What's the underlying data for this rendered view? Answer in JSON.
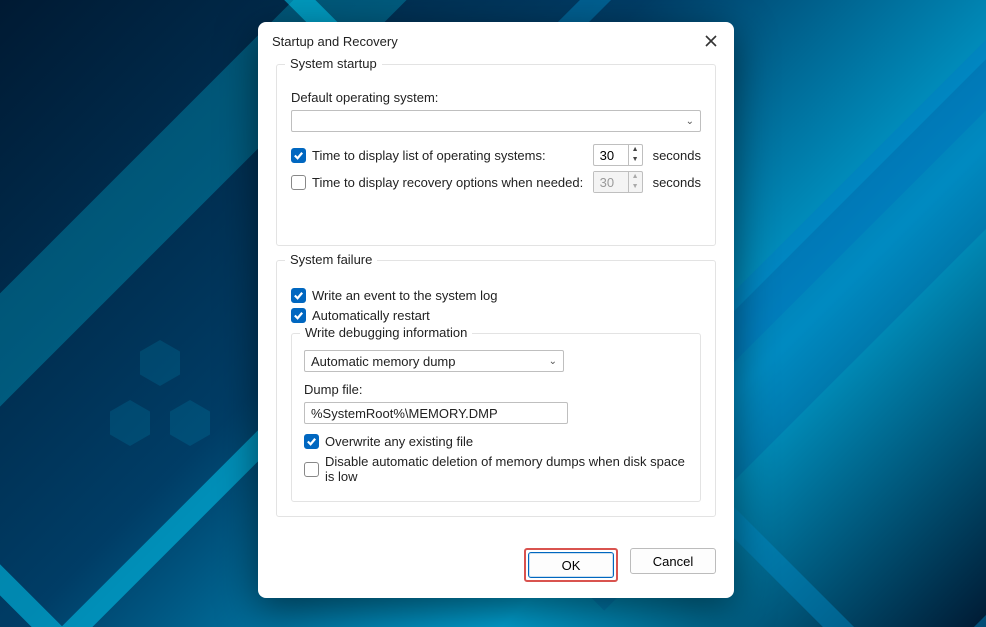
{
  "dialog": {
    "title": "Startup and Recovery"
  },
  "system_startup": {
    "legend": "System startup",
    "default_os_label": "Default operating system:",
    "default_os_value": "",
    "display_list": {
      "checked": true,
      "label": "Time to display list of operating systems:",
      "seconds": "30",
      "unit": "seconds"
    },
    "recovery_options": {
      "checked": false,
      "label": "Time to display recovery options when needed:",
      "seconds": "30",
      "unit": "seconds"
    }
  },
  "system_failure": {
    "legend": "System failure",
    "write_event": {
      "checked": true,
      "label": "Write an event to the system log"
    },
    "auto_restart": {
      "checked": true,
      "label": "Automatically restart"
    },
    "debug_info": {
      "legend": "Write debugging information",
      "dump_type": "Automatic memory dump",
      "dump_file_label": "Dump file:",
      "dump_file_value": "%SystemRoot%\\MEMORY.DMP",
      "overwrite": {
        "checked": true,
        "label": "Overwrite any existing file"
      },
      "disable_delete": {
        "checked": false,
        "label": "Disable automatic deletion of memory dumps when disk space is low"
      }
    }
  },
  "footer": {
    "ok": "OK",
    "cancel": "Cancel"
  }
}
